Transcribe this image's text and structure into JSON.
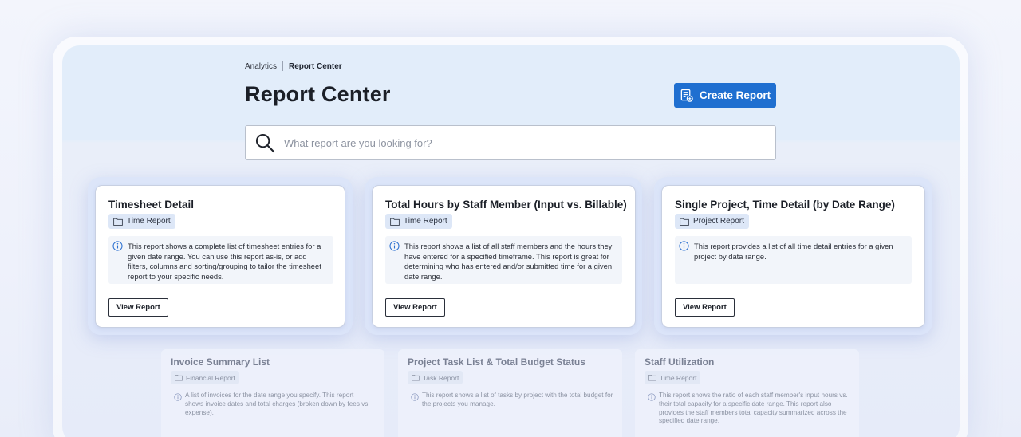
{
  "breadcrumb": {
    "root": "Analytics",
    "current": "Report Center"
  },
  "page": {
    "title": "Report Center"
  },
  "toolbar": {
    "create_label": "Create Report"
  },
  "search": {
    "placeholder": "What report are you looking for?"
  },
  "colors": {
    "accent": "#1f6fd0",
    "badge_bg": "#dde7f7",
    "header_bg": "#e2edfa"
  },
  "cards": [
    {
      "title": "Timesheet Detail",
      "category": "Time Report",
      "description": "This report shows a complete list of timesheet entries for a given date range. You can use this report as-is, or add filters, columns and sorting/grouping to tailor the timesheet report to your specific needs.",
      "button": "View Report"
    },
    {
      "title": "Total Hours by Staff Member (Input vs. Billable)",
      "category": "Time Report",
      "description": "This report shows a list of all staff members and the hours they have entered for a specified timeframe. This report is great for determining who has entered and/or submitted time for a given date range.",
      "button": "View Report"
    },
    {
      "title": "Single Project, Time Detail (by Date Range)",
      "category": "Project Report",
      "description": "This report provides a list of all time detail entries for a given project by data range.",
      "button": "View Report"
    }
  ],
  "faded_cards": [
    {
      "title": "Invoice Summary List",
      "category": "Financial Report",
      "description": "A list of invoices for the date range you specify. This report shows invoice dates and total charges (broken down by fees vs expense)."
    },
    {
      "title": "Project Task List & Total Budget Status",
      "category": "Task Report",
      "description": "This report shows a list of tasks by project with the total budget for the projects you manage."
    },
    {
      "title": "Staff Utilization",
      "category": "Time Report",
      "description": "This report shows the ratio of each staff member's input hours vs. their total capacity for a specific date range. This report also provides the staff members total capacity summarized across the specified date range."
    }
  ]
}
